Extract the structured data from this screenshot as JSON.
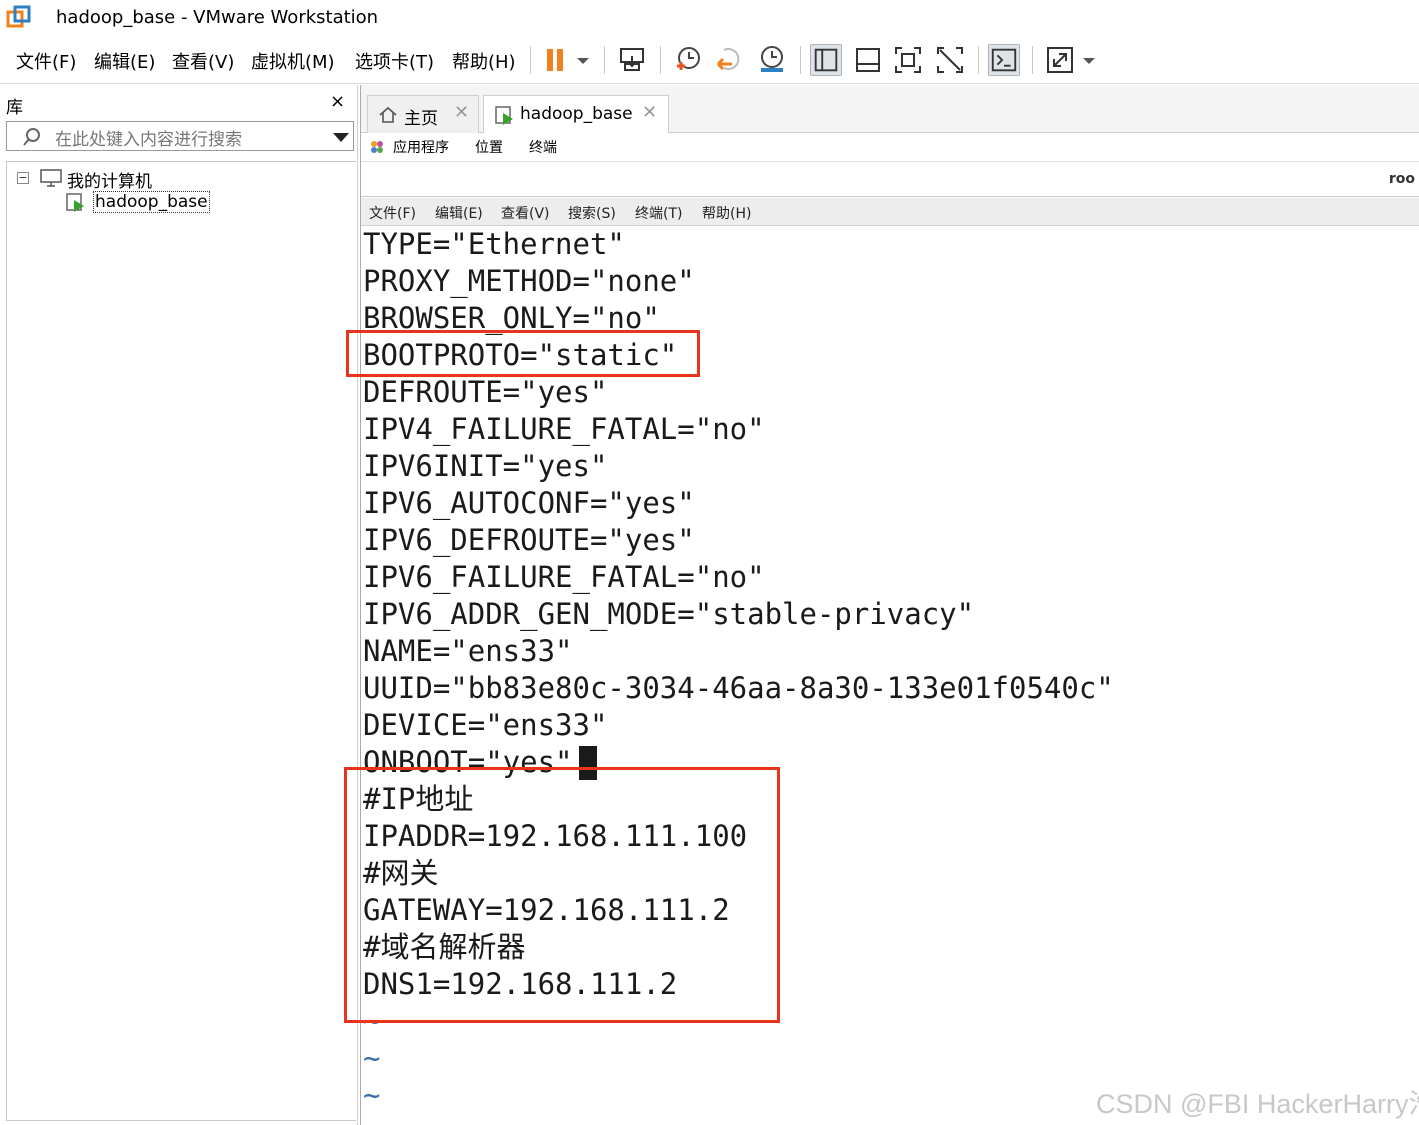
{
  "window": {
    "title": "hadoop_base - VMware Workstation"
  },
  "menubar": {
    "items": [
      "文件(F)",
      "编辑(E)",
      "查看(V)",
      "虚拟机(M)",
      "选项卡(T)",
      "帮助(H)"
    ]
  },
  "toolbar": {
    "icons": [
      "pause-icon",
      "dropdown-arrow-icon",
      "send-ctrl-alt-del-icon",
      "snapshot-take-icon",
      "snapshot-revert-icon",
      "snapshot-manager-icon",
      "library-view-icon",
      "thumbnail-bar-icon",
      "full-screen-icon",
      "unity-icon",
      "console-view-icon",
      "stretch-icon"
    ]
  },
  "library": {
    "title": "库",
    "close_label": "×",
    "search_placeholder": "在此处键入内容进行搜索",
    "tree": {
      "root_label": "我的计算机",
      "expander": "−",
      "vm_label": "hadoop_base"
    }
  },
  "tabs": [
    {
      "label": "主页",
      "active": false
    },
    {
      "label": "hadoop_base",
      "active": true
    }
  ],
  "tab_close_label": "✕",
  "gnome_menu": {
    "items": [
      "应用程序",
      "位置",
      "终端"
    ],
    "right_partial": "roo"
  },
  "terminal_menu": {
    "items": [
      "文件(F)",
      "编辑(E)",
      "查看(V)",
      "搜索(S)",
      "终端(T)",
      "帮助(H)"
    ]
  },
  "terminal": {
    "lines": [
      "TYPE=\"Ethernet\"",
      "PROXY_METHOD=\"none\"",
      "BROWSER_ONLY=\"no\"",
      "BOOTPROTO=\"static\"",
      "DEFROUTE=\"yes\"",
      "IPV4_FAILURE_FATAL=\"no\"",
      "IPV6INIT=\"yes\"",
      "IPV6_AUTOCONF=\"yes\"",
      "IPV6_DEFROUTE=\"yes\"",
      "IPV6_FAILURE_FATAL=\"no\"",
      "IPV6_ADDR_GEN_MODE=\"stable-privacy\"",
      "NAME=\"ens33\"",
      "UUID=\"bb83e80c-3034-46aa-8a30-133e01f0540c\"",
      "DEVICE=\"ens33\"",
      "ONBOOT=\"yes\"",
      "#IP地址",
      "IPADDR=192.168.111.100",
      "#网关",
      "GATEWAY=192.168.111.2",
      "#域名解析器",
      "DNS1=192.168.111.2",
      "~",
      "~",
      "~"
    ]
  },
  "watermark": "CSDN @FBI HackerHarry浩",
  "colors": {
    "highlight": "#e8341c",
    "pause_orange": "#f0821e",
    "vm_green": "#3aa02c",
    "tilde_blue": "#3a6ea5"
  }
}
